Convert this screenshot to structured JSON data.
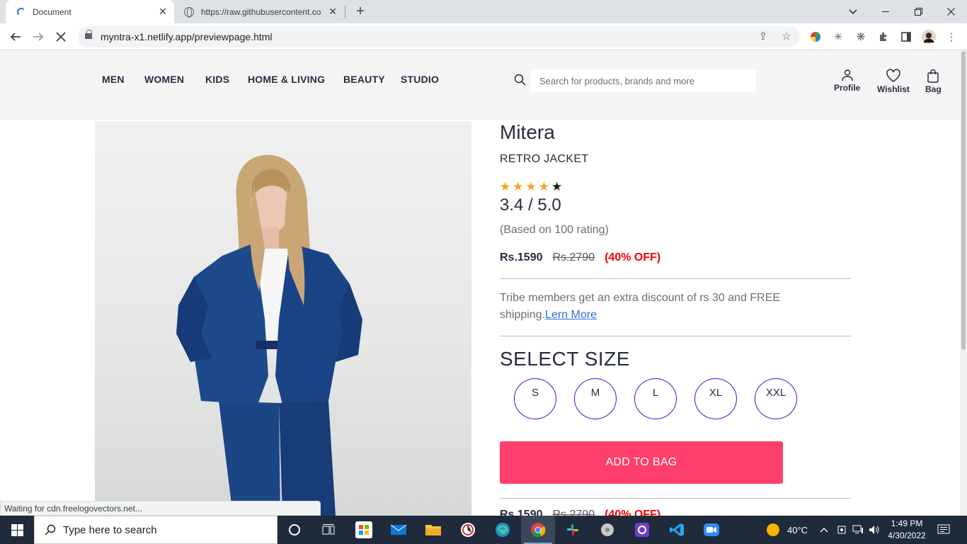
{
  "browser": {
    "tabs": [
      {
        "title": "Document",
        "active": true
      },
      {
        "title": "https://raw.githubusercontent.co",
        "active": false
      }
    ],
    "address": "myntra-x1.netlify.app/previewpage.html",
    "status_text": "Waiting for cdn.freelogovectors.net..."
  },
  "header": {
    "nav": [
      "MEN",
      "WOMEN",
      "KIDS",
      "HOME & LIVING",
      "BEAUTY",
      "STUDIO"
    ],
    "search_placeholder": "Search for products, brands and more",
    "actions": {
      "profile": "Profile",
      "wishlist": "Wishlist",
      "bag": "Bag"
    }
  },
  "product": {
    "brand": "Mitera",
    "name": "RETRO JACKET",
    "stars_filled": 4,
    "stars_total": 5,
    "rating": "3.4 / 5.0",
    "rating_count": "(Based on 100 rating)",
    "price": "Rs.1590",
    "mrp": "Rs.2790",
    "discount": "(40% OFF)",
    "tribe_text": "Tribe members get an extra discount of rs 30 and FREE shipping.",
    "tribe_link": "Lern More",
    "select_size_label": "SELECT SIZE",
    "sizes": [
      "S",
      "M",
      "L",
      "XL",
      "XXL"
    ],
    "add_to_bag": "ADD TO BAG"
  },
  "taskbar": {
    "search_text": "Type here to search",
    "weather": "40°C",
    "time": "1:49 PM",
    "date": "4/30/2022"
  },
  "colors": {
    "accent": "#ff3f6c",
    "discount": "#f50000",
    "star_filled": "#f7a41d",
    "size_border": "#2323d0"
  }
}
